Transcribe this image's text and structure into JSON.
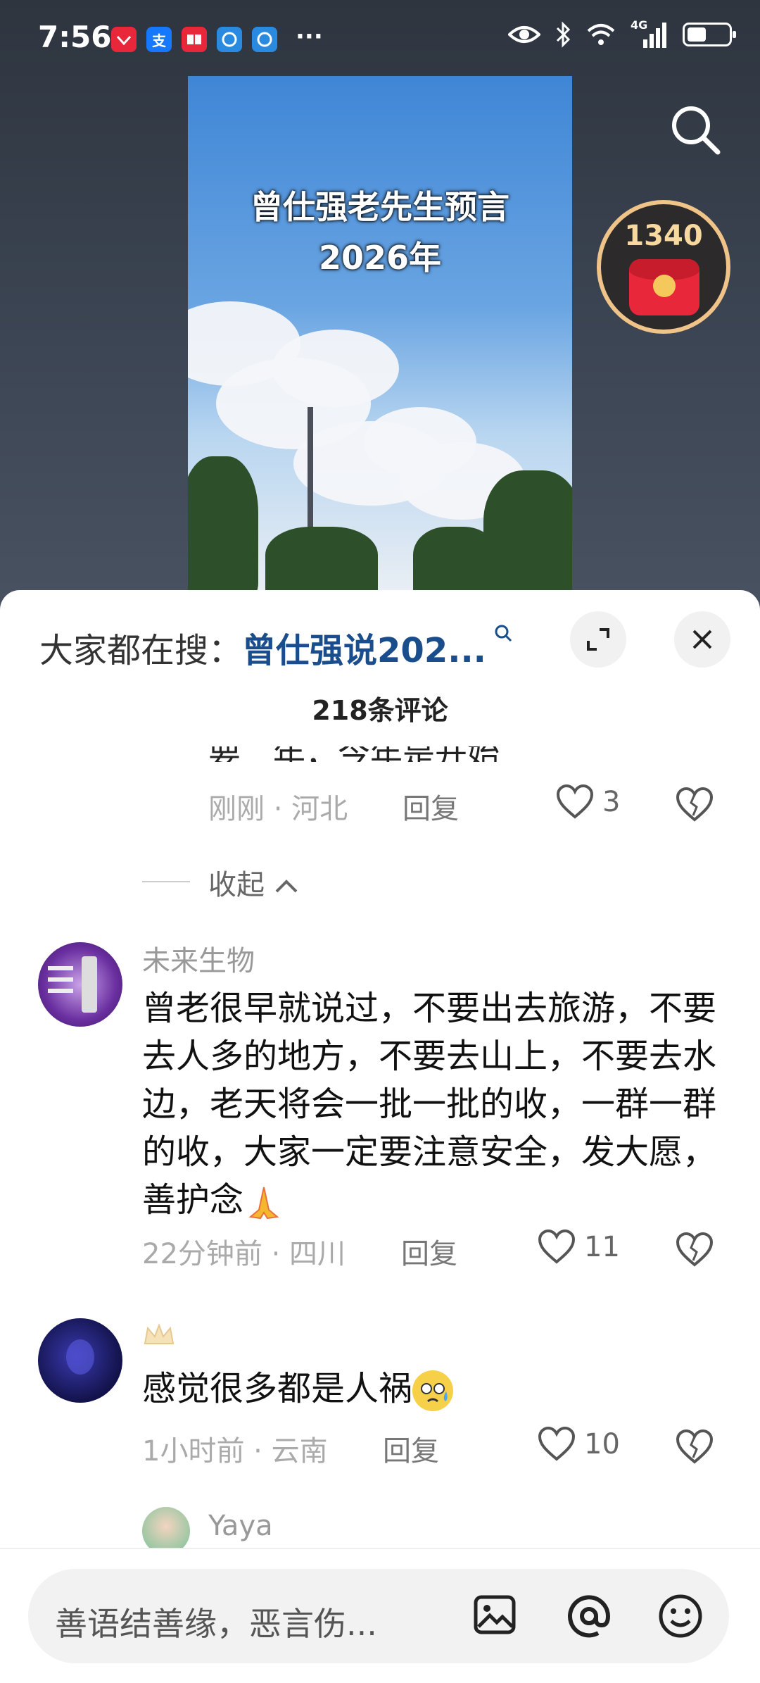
{
  "status": {
    "time": "7:56",
    "apps": [
      {
        "name": "huawei-app-icon",
        "color": "#e8283a",
        "glyph": ""
      },
      {
        "name": "alipay-icon",
        "color": "#1677ff",
        "glyph": "支"
      },
      {
        "name": "book-app-icon",
        "color": "#e8283a",
        "glyph": ""
      },
      {
        "name": "browser-icon",
        "color": "#2a8ae0",
        "glyph": ""
      },
      {
        "name": "browser-icon-2",
        "color": "#2a8ae0",
        "glyph": ""
      }
    ],
    "more": "···",
    "network": "4G"
  },
  "video": {
    "title_line1": "曾仕强老先生预言",
    "title_line2": "2026年"
  },
  "reward": {
    "count": "1340"
  },
  "sheet": {
    "hot_prefix": "大家都在搜：",
    "hot_keyword": "曾仕强说202...",
    "comment_count": "218条评论",
    "partial_text": "要二年，今年是开始",
    "partial_meta": "刚刚 · 河北",
    "partial_likes": "3",
    "reply_label": "回复",
    "collapse_label": "收起",
    "comments": [
      {
        "user": "未来生物",
        "text": "曾老很早就说过，不要出去旅游，不要去人多的地方，不要去山上，不要去水边，老天将会一批一批的收，一群一群的收，大家一定要注意安全，发大愿，善护念",
        "meta": "22分钟前 · 四川",
        "likes": "11"
      },
      {
        "user": "",
        "text": "感觉很多都是人祸",
        "meta": "1小时前 · 云南",
        "likes": "10"
      },
      {
        "user": "Yaya",
        "text": "",
        "meta": "",
        "likes": ""
      }
    ]
  },
  "input": {
    "placeholder": "善语结善缘，恶言伤..."
  }
}
